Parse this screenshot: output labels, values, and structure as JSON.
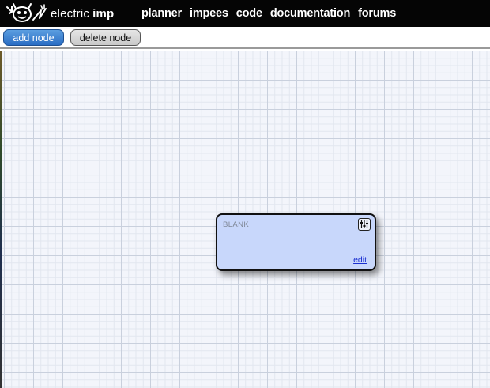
{
  "header": {
    "logo_word1": "electric",
    "logo_word2": "imp",
    "nav": [
      {
        "label": "planner"
      },
      {
        "label": "impees"
      },
      {
        "label": "code"
      },
      {
        "label": "documentation"
      },
      {
        "label": "forums"
      }
    ]
  },
  "toolbar": {
    "add_label": "add node",
    "delete_label": "delete node"
  },
  "canvas": {
    "node": {
      "title": "BLANK",
      "edit_label": "edit",
      "settings_icon": "sliders-icon"
    }
  },
  "colors": {
    "topbar": "#050505",
    "add_button": "#2a6dc4",
    "node_fill": "#c8d7fb",
    "grid_bg": "#f3f5fb",
    "link": "#1a2fd0"
  }
}
